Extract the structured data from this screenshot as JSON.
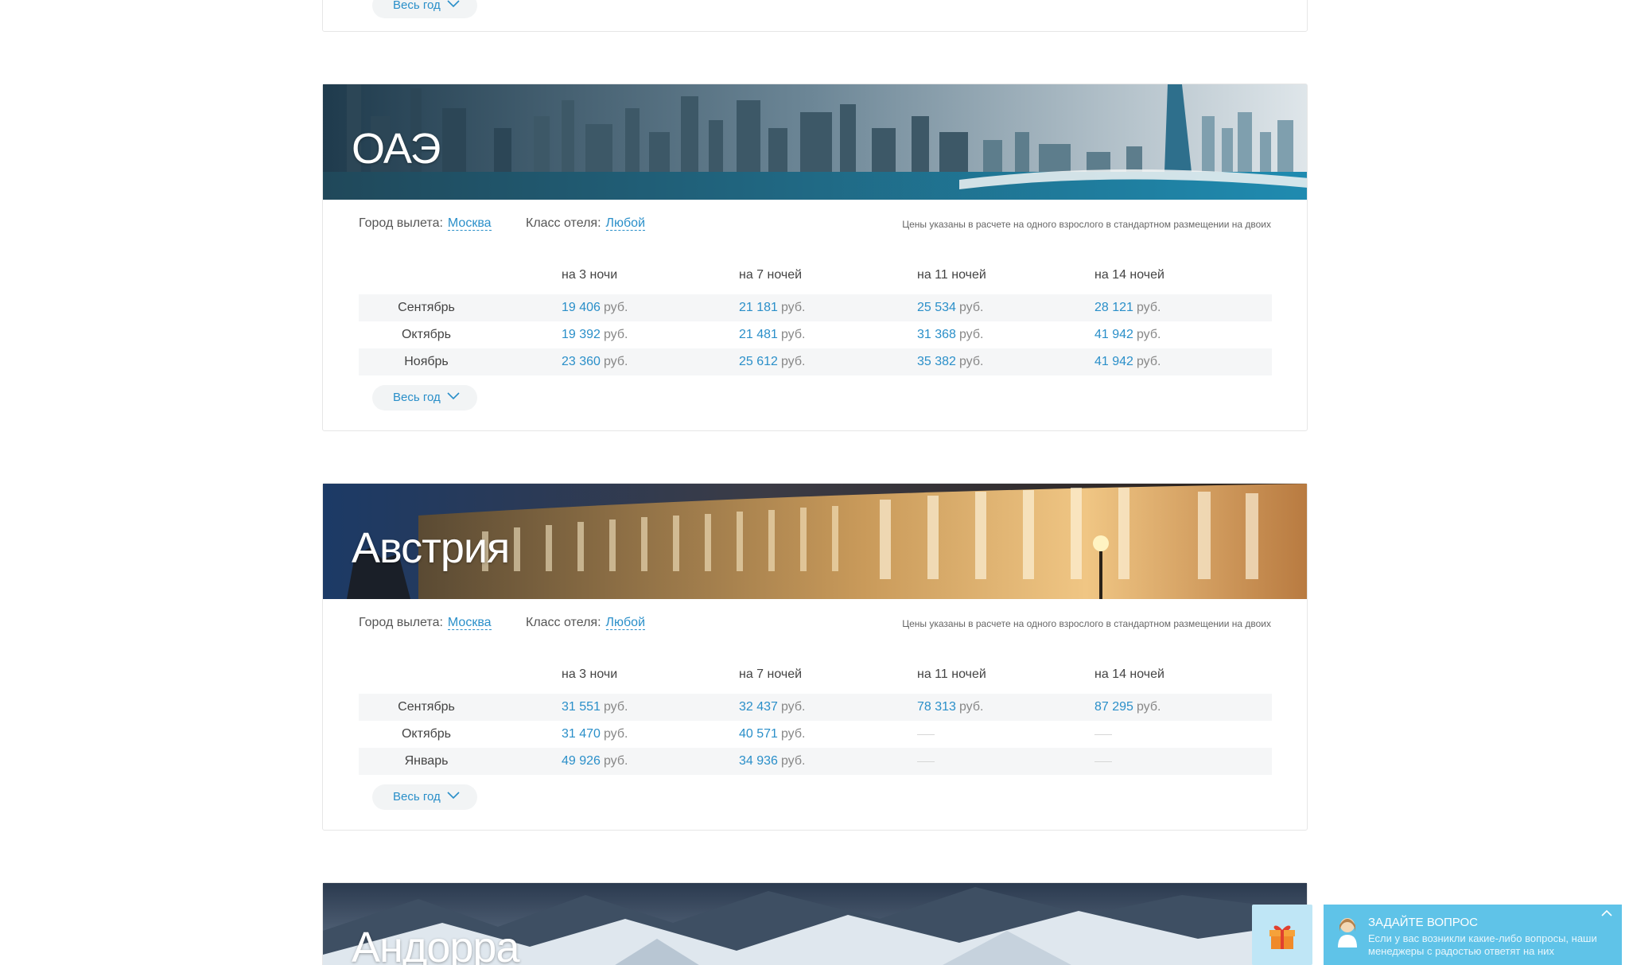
{
  "top_card": {
    "button_label": "Весь год"
  },
  "destinations": [
    {
      "name": "ОАЭ",
      "filters": {
        "city_label": "Город вылета:",
        "city_value": "Москва",
        "class_label": "Класс отеля:",
        "class_value": "Любой",
        "note": "Цены указаны в расчете на одного взрослого в стандартном размещении на двоих"
      },
      "columns": [
        "на 3 ночи",
        "на 7 ночей",
        "на 11 ночей",
        "на 14 ночей"
      ],
      "currency": "руб.",
      "rows": [
        {
          "month": "Сентябрь",
          "prices": [
            "19 406",
            "21 181",
            "25 534",
            "28 121"
          ]
        },
        {
          "month": "Октябрь",
          "prices": [
            "19 392",
            "21 481",
            "31 368",
            "41 942"
          ]
        },
        {
          "month": "Ноябрь",
          "prices": [
            "23 360",
            "25 612",
            "35 382",
            "41 942"
          ]
        }
      ],
      "button_label": "Весь год"
    },
    {
      "name": "Австрия",
      "filters": {
        "city_label": "Город вылета:",
        "city_value": "Москва",
        "class_label": "Класс отеля:",
        "class_value": "Любой",
        "note": "Цены указаны в расчете на одного взрослого в стандартном размещении на двоих"
      },
      "columns": [
        "на 3 ночи",
        "на 7 ночей",
        "на 11 ночей",
        "на 14 ночей"
      ],
      "currency": "руб.",
      "rows": [
        {
          "month": "Сентябрь",
          "prices": [
            "31 551",
            "32 437",
            "78 313",
            "87 295"
          ]
        },
        {
          "month": "Октябрь",
          "prices": [
            "31 470",
            "40 571",
            null,
            null
          ]
        },
        {
          "month": "Январь",
          "prices": [
            "49 926",
            "34 936",
            null,
            null
          ]
        }
      ],
      "button_label": "Весь год"
    },
    {
      "name": "Андорра"
    }
  ],
  "chat_widget": {
    "title": "ЗАДАЙТЕ ВОПРОС",
    "text": "Если у вас возникли какие-либо вопросы, наши менеджеры с радостью ответят на них"
  },
  "icons": {
    "gift": "gift-icon",
    "chevron": "chevron-down-icon",
    "avatar": "operator-avatar-icon",
    "collapse": "chevron-up-icon"
  },
  "colors": {
    "accent": "#2a8fc9",
    "chat_bg": "#5fc3e8",
    "gift_bg": "#bfe6f6"
  }
}
